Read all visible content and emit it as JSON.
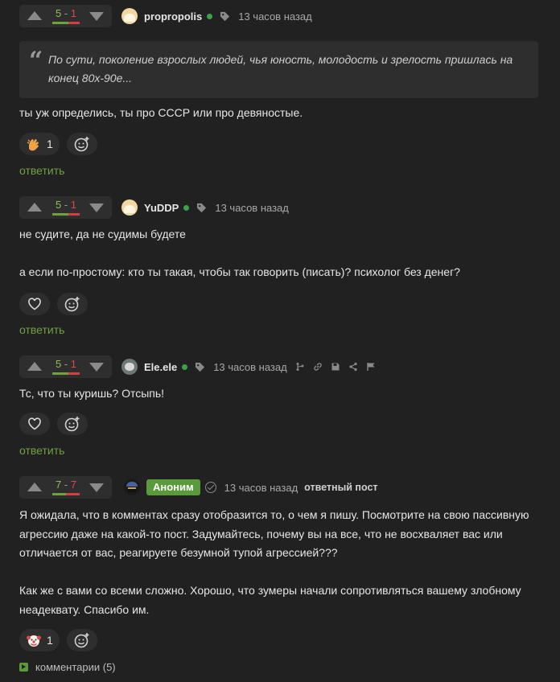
{
  "comments": [
    {
      "score": {
        "plus": "5",
        "sep": " - ",
        "minus": "1"
      },
      "bar_fraction_plus": 0.6,
      "author": "propropolis",
      "online": true,
      "time": "13 часов назад",
      "quote": "По сути, поколение взрослых людей, чья юность, молодость и зрелость пришлась на конец 80х-90е...",
      "lines": [
        "ты уж определись, ты про СССР или про девяностые."
      ],
      "reactions": [
        {
          "icon": "waving-hand-icon",
          "count": "1"
        }
      ],
      "reply": "ответить"
    },
    {
      "score": {
        "plus": "5",
        "sep": " - ",
        "minus": "1"
      },
      "bar_fraction_plus": 0.6,
      "author": "YuDDP",
      "online": true,
      "time": "13 часов назад",
      "lines": [
        "не судите, да не судимы будете",
        "",
        "а если по-простому: кто ты такая, чтобы так говорить (писать)? психолог без денег?"
      ],
      "reply": "ответить"
    },
    {
      "score": {
        "plus": "5",
        "sep": " - ",
        "minus": "1"
      },
      "bar_fraction_plus": 0.6,
      "author": "Ele.ele",
      "online": true,
      "time": "13 часов назад",
      "lines": [
        "Тс, что ты куришь? Отсыпь!"
      ],
      "reply": "ответить"
    },
    {
      "score": {
        "plus": "7",
        "sep": " - ",
        "minus": "7"
      },
      "bar_fraction_plus": 0.5,
      "author_badge": "Аноним",
      "time": "13 часов назад",
      "post_label": "ответный пост",
      "lines": [
        "Я ожидала, что в комментах сразу отобразится то, о чем я пишу. Посмотрите на свою пассивную",
        "агрессию даже на какой-то пост. Задумайтесь, почему вы на все, что не восхваляет вас или",
        "отличается от вас, реагируете безумной тупой агрессией???",
        "",
        "Как же с вами со всеми сложно. Хорошо, что зумеры начали сопротивляться вашему злобному",
        "неадеквату. Спасибо им."
      ],
      "reactions": [
        {
          "icon": "clown-face-icon",
          "count": "1"
        }
      ],
      "more_comments": "комментарии (5)"
    }
  ],
  "colors": {
    "background": "#212121",
    "plus": "#8fbf4d",
    "minus": "#e0444c",
    "reply": "#70a040",
    "badge": "#5a9a3c"
  }
}
